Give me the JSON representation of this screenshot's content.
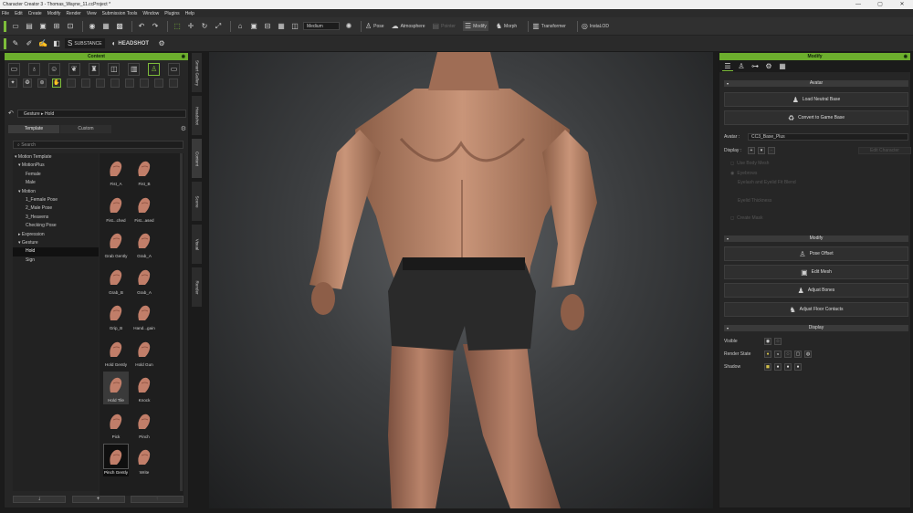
{
  "window": {
    "title": "Character Creator 3 - Thomas_Wayne_11.ccProject *",
    "controls": [
      "—",
      "▢",
      "✕"
    ]
  },
  "menu": [
    "File",
    "Edit",
    "Create",
    "Modify",
    "Render",
    "View",
    "Submission Tools",
    "Window",
    "Plugins",
    "Help"
  ],
  "toolbar": {
    "quality": "Medium",
    "pose": "Pose",
    "atmosphere": "Atmosphere",
    "pointer": "Pointer",
    "modify": "Modify",
    "morph": "Morph",
    "transformer": "Transformer",
    "insta": "InstaLOD"
  },
  "toolbar2": {
    "substance": "SUBSTANCE",
    "headshot": "HEADSHOT"
  },
  "content": {
    "title": "Content",
    "breadcrumb": "Gesture ▸ Hold",
    "tabs": [
      "Template",
      "Custom"
    ],
    "search_placeholder": "Search",
    "tree": [
      {
        "label": "▾ Motion Template",
        "indent": 0
      },
      {
        "label": "▾ MotionPlus",
        "indent": 1
      },
      {
        "label": "Female",
        "indent": 3
      },
      {
        "label": "Male",
        "indent": 3
      },
      {
        "label": "▾ Motion",
        "indent": 1
      },
      {
        "label": "1_Female Pose",
        "indent": 3
      },
      {
        "label": "2_Male Pose",
        "indent": 3
      },
      {
        "label": "3_Heavens",
        "indent": 3
      },
      {
        "label": "Checking Pose",
        "indent": 3
      },
      {
        "label": "▸ Expression",
        "indent": 1
      },
      {
        "label": "▾ Gesture",
        "indent": 1
      },
      {
        "label": "Hold",
        "indent": 3,
        "selected": true
      },
      {
        "label": "Sign",
        "indent": 3
      }
    ],
    "thumbs": [
      "Fist_A",
      "Fist_B",
      "Fist...ched",
      "Fist...ased",
      "Grab Gently",
      "Grab_A",
      "Grab_B",
      "Grab_A",
      "Grip_B",
      "Hand...gain",
      "Hold Gently",
      "Hold Gun",
      "Hold Tile",
      "Knock",
      "Pick",
      "Pinch",
      "Pinch Gently",
      "Write"
    ],
    "bottom_buttons": [
      "↓",
      "+",
      "↑"
    ]
  },
  "side_tabs": [
    "Smart Gallery",
    "Headshot",
    "Content",
    "Scene",
    "Visual",
    "Render"
  ],
  "modify": {
    "title": "Modify",
    "sections": {
      "avatar": "Avatar",
      "modify": "Modify",
      "display": "Display"
    },
    "buttons": {
      "load_neutral": "Load Neutral Base",
      "convert": "Convert to Game Base",
      "pose_offset": "Pose Offset",
      "edit_mesh": "Edit Mesh",
      "adjust_bones": "Adjust Bones",
      "adjust_floor": "Adjust Floor Contacts"
    },
    "avatar_label": "Avatar :",
    "avatar_value": "CC3_Base_Plus",
    "display_label": "Display :",
    "dim_button": "Edit Character",
    "dim_items": [
      "Use Body Mesh",
      "Eyebrows",
      "Eyelash and Eyelid Fit Blend",
      "Eyelid Thickness",
      "Create Mask"
    ],
    "visible": "Visible",
    "render_state": "Render State",
    "shadow": "Shadow"
  }
}
